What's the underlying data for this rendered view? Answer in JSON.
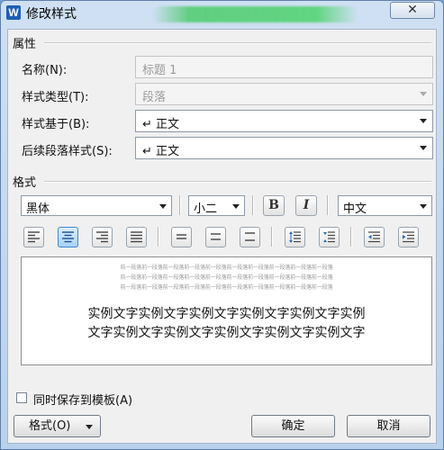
{
  "window": {
    "title": "修改样式",
    "app_icon": "W",
    "close_glyph": "✕"
  },
  "properties": {
    "heading": "属性",
    "name_label": "名称(N):",
    "name_value": "标题 1",
    "type_label": "样式类型(T):",
    "type_value": "段落",
    "based_on_label": "样式基于(B):",
    "based_on_value": "↵ 正文",
    "next_label": "后续段落样式(S):",
    "next_value": "↵ 正文"
  },
  "format": {
    "heading": "格式",
    "font": "黑体",
    "size": "小二",
    "bold": "B",
    "italic": "I",
    "script": "中文",
    "alignment_selected": "center"
  },
  "preview": {
    "prev_lines": [
      "前一段落前一段落前一段落前一段落前一段落前一段落前一段落前一段落前一段落前一段落",
      "前一段落前一段落前一段落前一段落前一段落前一段落前一段落前一段落前一段落前一段落",
      "前一段落前一段落前一段落前一段落前一段落前一段落前一段落前一段落前一段落前一段落"
    ],
    "sample_lines": [
      "实例文字实例文字实例文字实例文字实例文字实例",
      "文字实例文字实例文字实例文字实例文字实例文字"
    ]
  },
  "footer": {
    "save_template_label": "同时保存到模板(A)",
    "format_button": "格式(O)",
    "ok_button": "确定",
    "cancel_button": "取消"
  },
  "colors": {
    "active_button": "#a8d2fb",
    "title_bar": "#cfe0f3"
  }
}
